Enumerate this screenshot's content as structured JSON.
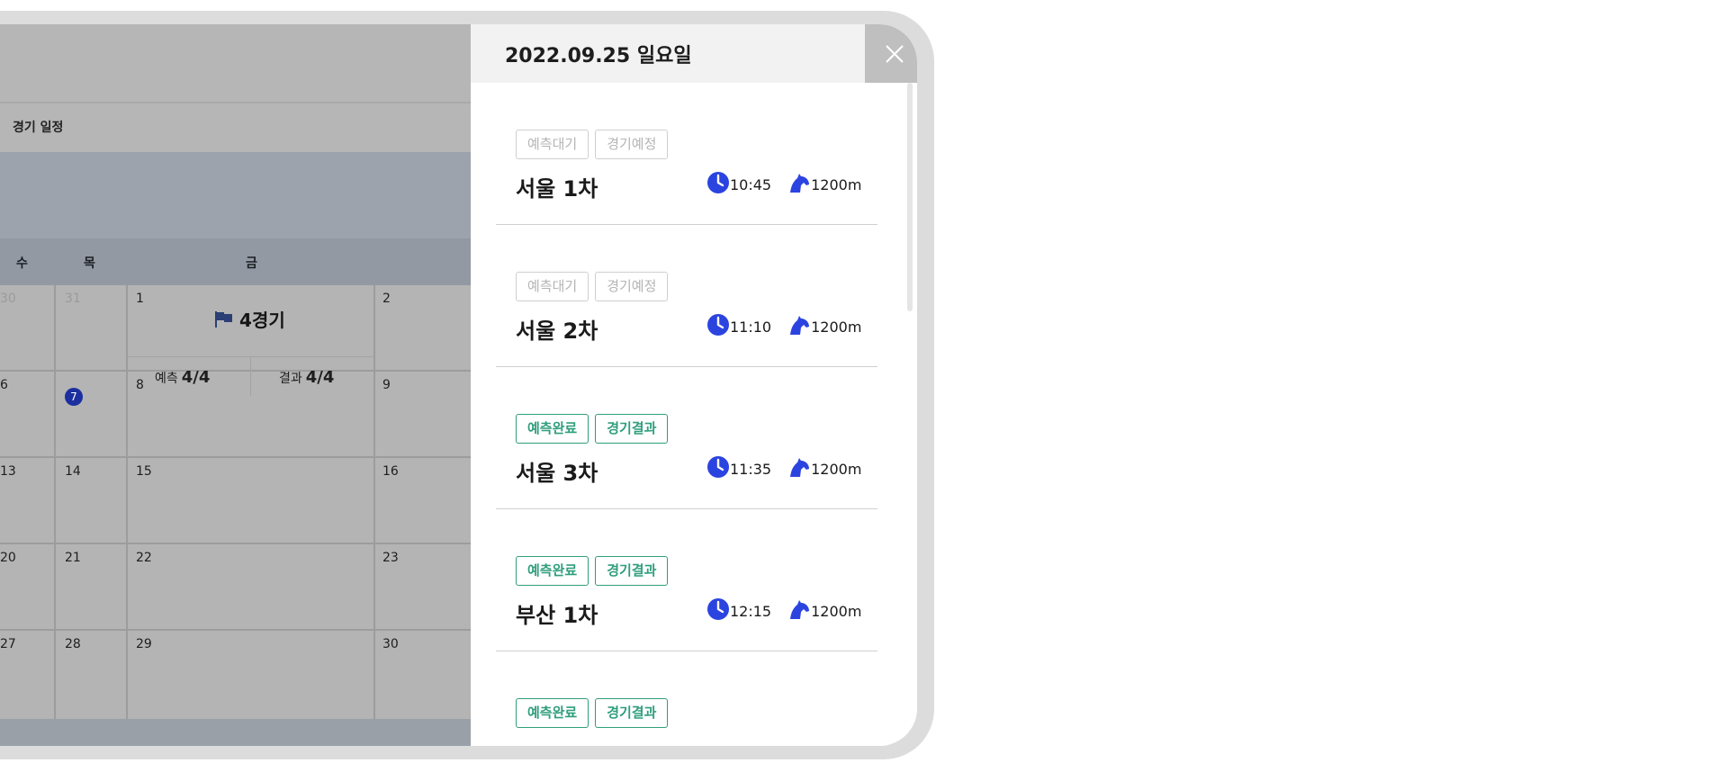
{
  "background_calendar": {
    "title": "경기 일정",
    "weekdays": [
      "수",
      "목",
      "금"
    ],
    "rows": [
      [
        "30",
        "31",
        "1",
        "2"
      ],
      [
        "6",
        "7",
        "8",
        "9"
      ],
      [
        "13",
        "14",
        "15",
        "16"
      ],
      [
        "20",
        "21",
        "22",
        "23"
      ],
      [
        "27",
        "28",
        "29",
        "30"
      ]
    ],
    "today": "7",
    "event": {
      "label": "4경기",
      "predict_label": "예측",
      "predict_value": "4/4",
      "result_label": "결과",
      "result_value": "4/4"
    }
  },
  "panel": {
    "date": "2022.09.25 일요일",
    "close_icon": "close-icon",
    "races": [
      {
        "tags": [
          "예측대기",
          "경기예정"
        ],
        "status": "pending",
        "name": "서울 1차",
        "time": "10:45",
        "distance": "1200m"
      },
      {
        "tags": [
          "예측대기",
          "경기예정"
        ],
        "status": "pending",
        "name": "서울 2차",
        "time": "11:10",
        "distance": "1200m"
      },
      {
        "tags": [
          "예측완료",
          "경기결과"
        ],
        "status": "done",
        "name": "서울 3차",
        "time": "11:35",
        "distance": "1200m"
      },
      {
        "tags": [
          "예측완료",
          "경기결과"
        ],
        "status": "done",
        "name": "부산 1차",
        "time": "12:15",
        "distance": "1200m"
      },
      {
        "tags": [
          "예측완료",
          "경기결과"
        ],
        "status": "done",
        "name": "",
        "time": "",
        "distance": ""
      }
    ]
  },
  "colors": {
    "accent_blue": "#2b44e0",
    "done_green": "#2f9e7c",
    "pending_gray": "#b4b4b4",
    "today_circle": "#1b2f9e"
  }
}
